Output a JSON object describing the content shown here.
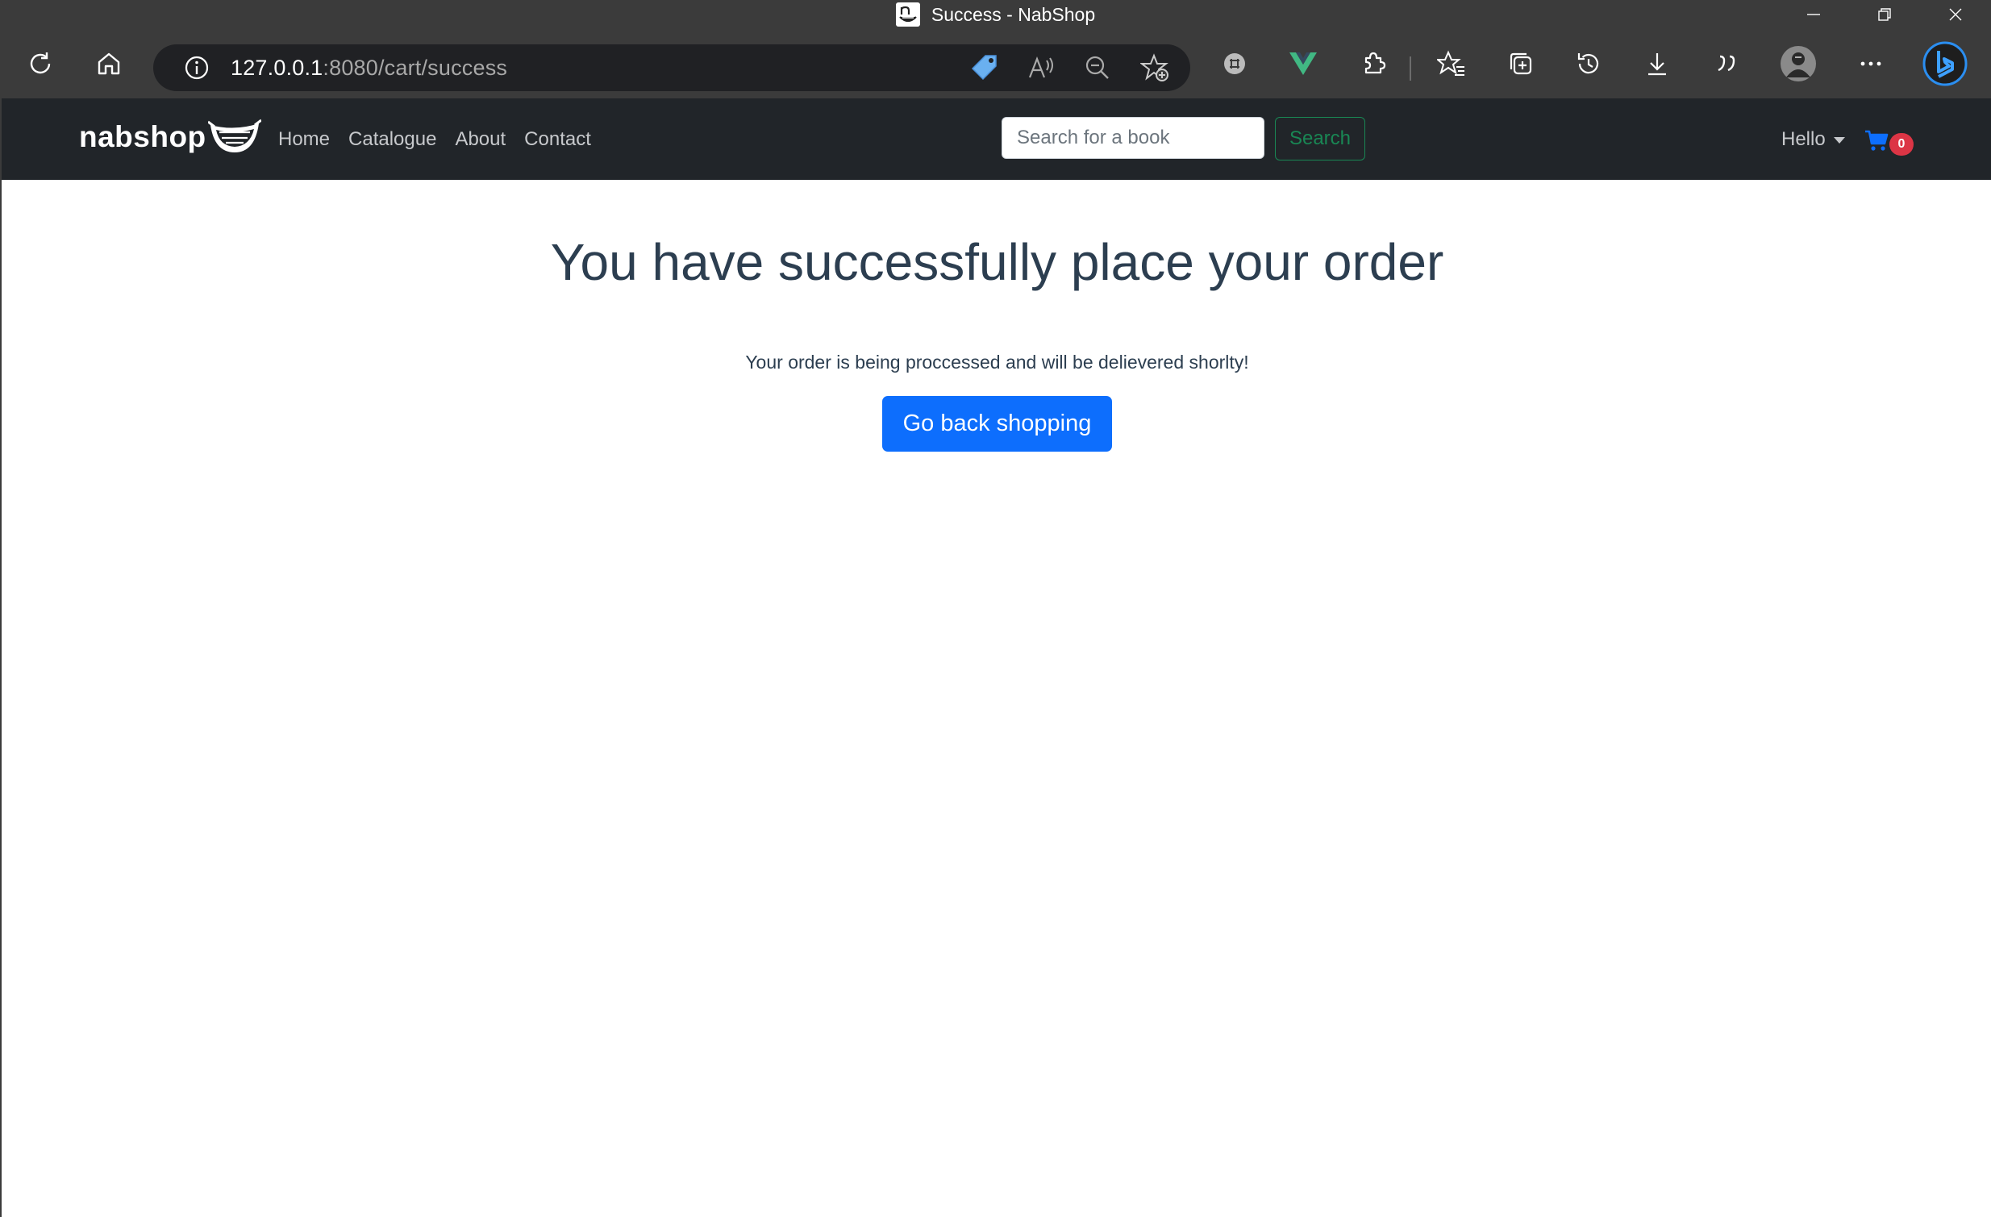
{
  "window": {
    "tab_title": "Success - NabShop",
    "favicon": "nabshop-logo-icon"
  },
  "browser": {
    "url_host": "127.0.0.1",
    "url_path": ":8080/cart/success",
    "toolbar_icons": [
      "refresh-icon",
      "home-icon",
      "site-info-icon",
      "tag-icon",
      "read-aloud-icon",
      "zoom-out-icon",
      "add-favorite-icon",
      "extension-icon",
      "vue-icon",
      "extensions-icon",
      "favorites-icon",
      "collections-icon",
      "history-icon",
      "downloads-icon",
      "quote-icon",
      "profile-avatar",
      "more-icon",
      "bing-icon"
    ]
  },
  "navbar": {
    "brand": "nabshop",
    "links": [
      "Home",
      "Catalogue",
      "About",
      "Contact"
    ],
    "search_placeholder": "Search for a book",
    "search_button": "Search",
    "user_menu": "Hello",
    "cart_count": "0"
  },
  "content": {
    "heading": "You have successfully place your order",
    "message": "Your order is being proccessed and will be delievered shorlty!",
    "back_button": "Go back shopping"
  },
  "colors": {
    "browser_chrome": "#3b3b3b",
    "address_bar": "#202124",
    "navbar": "#212529",
    "primary": "#0d6efd",
    "success": "#198754",
    "danger": "#dc3545",
    "heading_text": "#2c3e50"
  }
}
